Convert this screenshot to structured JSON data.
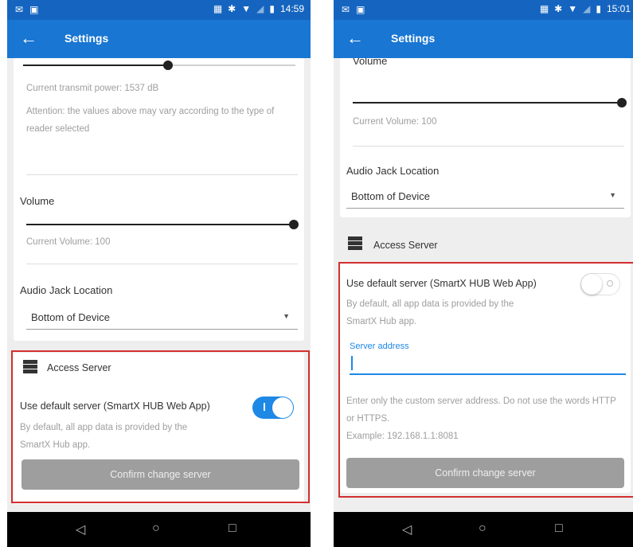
{
  "left": {
    "status": {
      "time": "14:59"
    },
    "appbar": {
      "title": "Settings"
    },
    "power": {
      "current": "Current transmit power: 1537 dB",
      "attention": "Attention: the values above may vary according to the type of reader selected"
    },
    "volume": {
      "label": "Volume",
      "current": "Current Volume: 100"
    },
    "audio_jack": {
      "label": "Audio Jack Location",
      "value": "Bottom of Device"
    },
    "access_server": {
      "header": "Access Server",
      "use_default_label": "Use default server (SmartX HUB Web App)",
      "use_default_desc": "By default, all app data is provided by the SmartX Hub app.",
      "toggle_on": true,
      "confirm_button": "Confirm change server"
    }
  },
  "right": {
    "status": {
      "time": "15:01"
    },
    "appbar": {
      "title": "Settings"
    },
    "volume": {
      "label": "Volume",
      "current": "Current Volume: 100"
    },
    "audio_jack": {
      "label": "Audio Jack Location",
      "value": "Bottom of Device"
    },
    "access_server": {
      "header": "Access Server",
      "use_default_label": "Use default server (SmartX HUB Web App)",
      "use_default_desc": "By default, all app data is provided by the SmartX Hub app.",
      "toggle_on": false,
      "server_address_label": "Server address",
      "server_address_value": "",
      "help_text": "Enter only the custom server address. Do not use the words HTTP or HTTPS.",
      "example": "Example: 192.168.1.1:8081",
      "confirm_button": "Confirm change server"
    }
  },
  "colors": {
    "status_bar": "#1565c0",
    "app_bar": "#1976d2",
    "accent": "#1e88e5",
    "highlight_box": "#d32f2f",
    "button_disabled": "#9e9e9e"
  }
}
